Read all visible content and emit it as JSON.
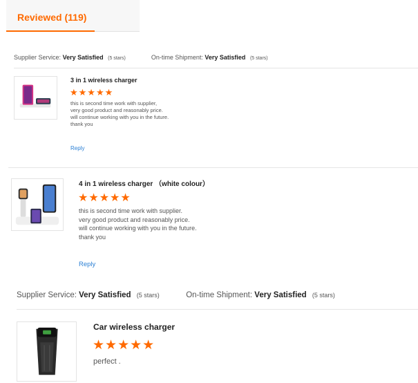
{
  "tab": {
    "label": "Reviewed (119)"
  },
  "ratings": [
    {
      "service_key": "Supplier Service:",
      "service_value": "Very Satisfied",
      "service_stars": "(5 stars)",
      "shipment_key": "On-time Shipment:",
      "shipment_value": "Very Satisfied",
      "shipment_stars": "(5 stars)"
    },
    {
      "service_key": "Supplier Service:",
      "service_value": "Very Satisfied",
      "service_stars": "(5 stars)",
      "shipment_key": "On-time Shipment:",
      "shipment_value": "Very Satisfied",
      "shipment_stars": "(5 stars)"
    }
  ],
  "reviews": [
    {
      "product": "3 in 1 wireless charger",
      "stars": "★★★★★",
      "rating": 5,
      "comment": [
        "this is second time work with supplier,",
        "very good product and reasonably price.",
        "will continue working with you in the future.",
        "thank you"
      ],
      "reply": "Reply"
    },
    {
      "product": "4 in 1 wireless charger （white colour）",
      "stars": "★★★★★",
      "rating": 5,
      "comment": [
        "this is second time work with supplier.",
        "very good product and reasonably price.",
        "will continue working with you in the future.",
        "thank you"
      ],
      "reply": "Reply"
    },
    {
      "product": "Car wireless charger",
      "stars": "★★★★★",
      "rating": 5,
      "comment": [
        "perfect ."
      ]
    }
  ],
  "colors": {
    "accent": "#ff6a00",
    "link": "#2a7fd4"
  }
}
